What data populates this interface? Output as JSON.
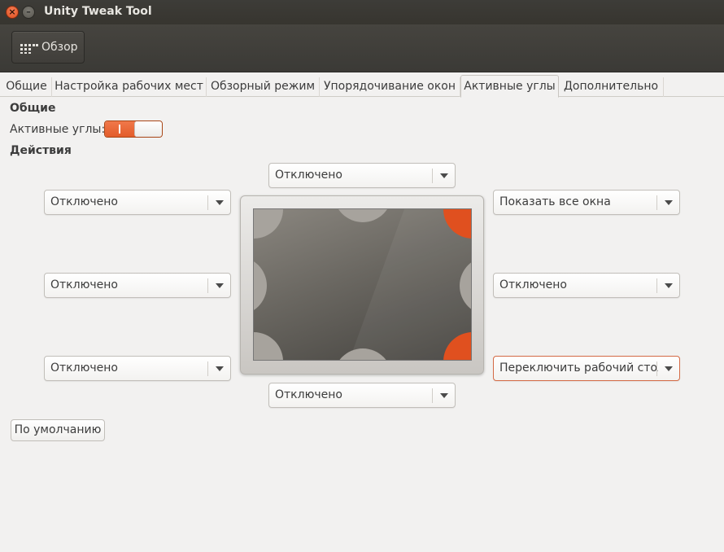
{
  "window": {
    "title": "Unity Tweak Tool",
    "close_symbol": "×",
    "minimize_symbol": "–"
  },
  "toolbar": {
    "overview_label": "Обзор"
  },
  "tabs": [
    {
      "label": "Общие",
      "active": false
    },
    {
      "label": "Настройка рабочих мест",
      "active": false
    },
    {
      "label": "Обзорный режим",
      "active": false
    },
    {
      "label": "Упорядочивание окон",
      "active": false
    },
    {
      "label": "Активные углы",
      "active": true
    },
    {
      "label": "Дополнительно",
      "active": false
    }
  ],
  "general": {
    "title": "Общие",
    "hotcorners_label": "Активные углы:",
    "hotcorners_enabled": true
  },
  "actions": {
    "title": "Действия",
    "top": "Отключено",
    "top_left": "Отключено",
    "top_right": "Показать все окна",
    "left": "Отключено",
    "right": "Отключено",
    "bottom_left": "Отключено",
    "bottom_right": "Переключить рабочий стол",
    "bottom": "Отключено"
  },
  "default_button": "По умолчанию",
  "colors": {
    "accent": "#e0501f",
    "titlebar": "#3d3c38",
    "background": "#f2f1f0"
  }
}
